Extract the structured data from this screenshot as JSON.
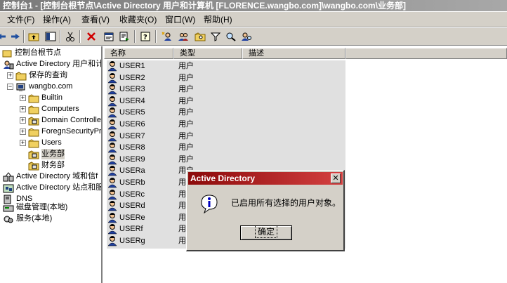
{
  "window": {
    "title": "控制台1 - [控制台根节点\\Active Directory 用户和计算机 [FLORENCE.wangbo.com]\\wangbo.com\\业务部]"
  },
  "menu": [
    "文件(F)",
    "操作(A)",
    "查看(V)",
    "收藏夹(O)",
    "窗口(W)",
    "帮助(H)"
  ],
  "toolbar": {
    "icons": [
      "back-icon",
      "forward-icon",
      "up-folder-icon",
      "show-tree-icon",
      "cut-icon",
      "delete-icon",
      "properties-icon",
      "export-icon",
      "help-icon",
      "new-user-icon",
      "new-group-icon",
      "new-ou-icon",
      "filter-icon",
      "find-icon"
    ]
  },
  "tree": {
    "root": "控制台根节点",
    "items": [
      "Active Directory 用户和计",
      "保存的查询",
      "wangbo.com",
      "Builtin",
      "Computers",
      "Domain Controller",
      "ForegnSecurityPr",
      "Users",
      "业务部",
      "财务部",
      "Active Directory 域和信f",
      "Active Directory 站点和服",
      "DNS",
      "磁盘管理(本地)",
      "服务(本地)"
    ]
  },
  "list": {
    "columns": [
      "名称",
      "类型",
      "描述"
    ],
    "rows": [
      {
        "name": "USER1",
        "type": "用户"
      },
      {
        "name": "USER2",
        "type": "用户"
      },
      {
        "name": "USER3",
        "type": "用户"
      },
      {
        "name": "USER4",
        "type": "用户"
      },
      {
        "name": "USER5",
        "type": "用户"
      },
      {
        "name": "USER6",
        "type": "用户"
      },
      {
        "name": "USER7",
        "type": "用户"
      },
      {
        "name": "USER8",
        "type": "用户"
      },
      {
        "name": "USER9",
        "type": "用户"
      },
      {
        "name": "USERa",
        "type": "用户"
      },
      {
        "name": "USERb",
        "type": "用"
      },
      {
        "name": "USERc",
        "type": "用"
      },
      {
        "name": "USERd",
        "type": "用"
      },
      {
        "name": "USERe",
        "type": "用"
      },
      {
        "name": "USERf",
        "type": "用"
      },
      {
        "name": "USERg",
        "type": "用"
      }
    ]
  },
  "dialog": {
    "title": "Active Directory",
    "close": "✕",
    "message": "已启用所有选择的用户对象。",
    "ok_label": "确定",
    "icon": "info-icon"
  },
  "colors": {
    "titlebar": "#7a7a7a",
    "dialog_titlebar": "#8b0a0a",
    "face": "#d4d0c8",
    "selected_rows": "#e0e0e0"
  }
}
